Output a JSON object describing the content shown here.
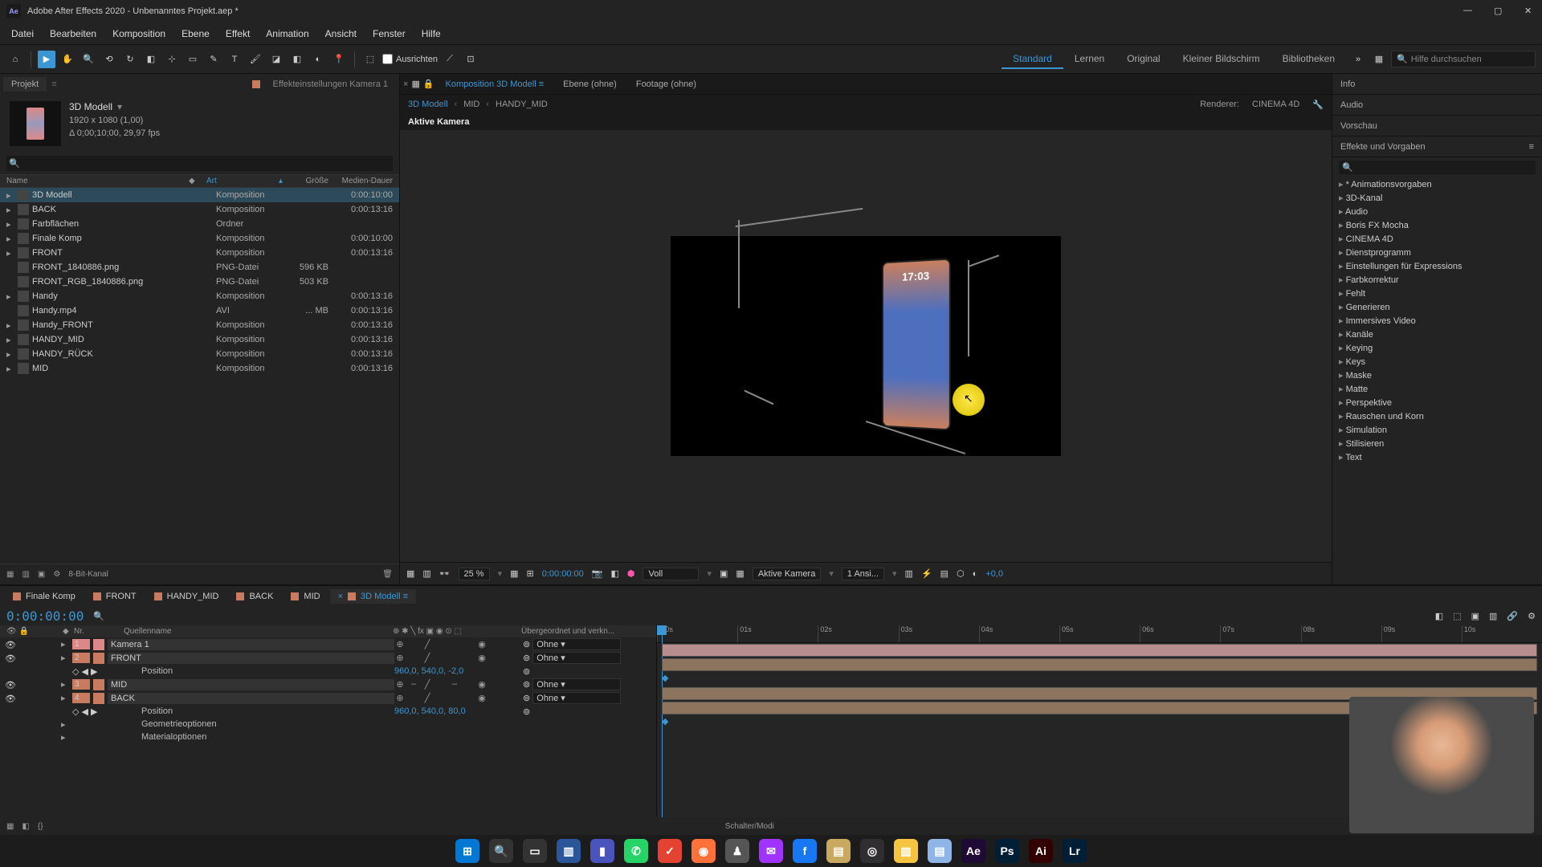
{
  "titlebar": {
    "title": "Adobe After Effects 2020 - Unbenanntes Projekt.aep *"
  },
  "menubar": [
    "Datei",
    "Bearbeiten",
    "Komposition",
    "Ebene",
    "Effekt",
    "Animation",
    "Ansicht",
    "Fenster",
    "Hilfe"
  ],
  "toolbar": {
    "snap_label": "Ausrichten",
    "workspaces": [
      "Standard",
      "Lernen",
      "Original",
      "Kleiner Bildschirm",
      "Bibliotheken"
    ],
    "active_workspace": "Standard",
    "search_placeholder": "Hilfe durchsuchen"
  },
  "project_panel": {
    "tab_project": "Projekt",
    "tab_effect_controls": "Effekteinstellungen Kamera 1",
    "selected_name": "3D Modell",
    "selected_dims": "1920 x 1080 (1,00)",
    "selected_dur": "Δ 0;00;10;00, 29,97 fps",
    "headers": {
      "name": "Name",
      "art": "Art",
      "size": "Größe",
      "dur": "Medien-Dauer"
    },
    "items": [
      {
        "name": "3D Modell",
        "type": "Komposition",
        "size": "",
        "dur": "0:00:10:00",
        "tag": "#b97b56",
        "sel": true,
        "exp": "▸"
      },
      {
        "name": "BACK",
        "type": "Komposition",
        "size": "",
        "dur": "0:00:13:16",
        "tag": "#b97b56",
        "exp": "▸"
      },
      {
        "name": "Farbflächen",
        "type": "Ordner",
        "size": "",
        "dur": "",
        "tag": "#b9b156",
        "exp": "▸"
      },
      {
        "name": "Finale Komp",
        "type": "Komposition",
        "size": "",
        "dur": "0:00:10:00",
        "tag": "#b97b56",
        "exp": "▸"
      },
      {
        "name": "FRONT",
        "type": "Komposition",
        "size": "",
        "dur": "0:00:13:16",
        "tag": "#b97b56",
        "exp": "▸"
      },
      {
        "name": "FRONT_1840886.png",
        "type": "PNG-Datei",
        "size": "596 KB",
        "dur": "",
        "tag": "#6b9b56"
      },
      {
        "name": "FRONT_RGB_1840886.png",
        "type": "PNG-Datei",
        "size": "503 KB",
        "dur": "",
        "tag": "#6b9b56"
      },
      {
        "name": "Handy",
        "type": "Komposition",
        "size": "",
        "dur": "0:00:13:16",
        "tag": "#b97b56",
        "exp": "▸"
      },
      {
        "name": "Handy.mp4",
        "type": "AVI",
        "size": "... MB",
        "dur": "0:00:13:16",
        "tag": "#d67b3e"
      },
      {
        "name": "Handy_FRONT",
        "type": "Komposition",
        "size": "",
        "dur": "0:00:13:16",
        "tag": "#b97b56",
        "exp": "▸"
      },
      {
        "name": "HANDY_MID",
        "type": "Komposition",
        "size": "",
        "dur": "0:00:13:16",
        "tag": "#b97b56",
        "exp": "▸"
      },
      {
        "name": "HANDY_RÜCK",
        "type": "Komposition",
        "size": "",
        "dur": "0:00:13:16",
        "tag": "#b97b56",
        "exp": "▸"
      },
      {
        "name": "MID",
        "type": "Komposition",
        "size": "",
        "dur": "0:00:13:16",
        "tag": "#b97b56",
        "exp": "▸"
      }
    ],
    "footer_bit": "8-Bit-Kanal"
  },
  "comp_panel": {
    "tab_comp_prefix": "Komposition",
    "tab_comp_name": "3D Modell",
    "tab_layer": "Ebene (ohne)",
    "tab_footage": "Footage (ohne)",
    "breadcrumb": [
      "3D Modell",
      "MID",
      "HANDY_MID"
    ],
    "renderer_label": "Renderer:",
    "renderer_value": "CINEMA 4D",
    "viewer_label": "Aktive Kamera",
    "phone_time": "17:03",
    "footer": {
      "zoom": "25 %",
      "time": "0:00:00:00",
      "res": "Voll",
      "camera": "Aktive Kamera",
      "views": "1 Ansi...",
      "exposure": "+0,0"
    }
  },
  "right_panel": {
    "info": "Info",
    "audio": "Audio",
    "preview": "Vorschau",
    "effects_title": "Effekte und Vorgaben",
    "effects": [
      "* Animationsvorgaben",
      "3D-Kanal",
      "Audio",
      "Boris FX Mocha",
      "CINEMA 4D",
      "Dienstprogramm",
      "Einstellungen für Expressions",
      "Farbkorrektur",
      "Fehlt",
      "Generieren",
      "Immersives Video",
      "Kanäle",
      "Keying",
      "Keys",
      "Maske",
      "Matte",
      "Perspektive",
      "Rauschen und Korn",
      "Simulation",
      "Stilisieren",
      "Text"
    ]
  },
  "timeline": {
    "tabs": [
      {
        "label": "Finale Komp",
        "color": "#c97b5f"
      },
      {
        "label": "FRONT",
        "color": "#c97b5f"
      },
      {
        "label": "HANDY_MID",
        "color": "#c97b5f"
      },
      {
        "label": "BACK",
        "color": "#c97b5f"
      },
      {
        "label": "MID",
        "color": "#c97b5f"
      },
      {
        "label": "3D Modell",
        "color": "#c97b5f",
        "active": true
      }
    ],
    "timecode": "0:00:00:00",
    "header": {
      "nr": "Nr.",
      "source": "Quellenname",
      "parent": "Übergeordnet und verkn..."
    },
    "ruler": [
      ":00s",
      "01s",
      "02s",
      "03s",
      "04s",
      "05s",
      "06s",
      "07s",
      "08s",
      "09s",
      "10s"
    ],
    "layers": [
      {
        "num": "1",
        "name": "Kamera 1",
        "tag": "#d88",
        "parent": "Ohne",
        "bar": "#b98d8d"
      },
      {
        "num": "2",
        "name": "FRONT",
        "tag": "#c97b5f",
        "parent": "Ohne",
        "bar": "#8c745f",
        "prop": {
          "label": "Position",
          "value": "960,0, 540,0, -2,0"
        }
      },
      {
        "num": "3",
        "name": "MID",
        "tag": "#c97b5f",
        "parent": "Ohne",
        "bar": "#8c745f",
        "dash": true
      },
      {
        "num": "4",
        "name": "BACK",
        "tag": "#c97b5f",
        "parent": "Ohne",
        "bar": "#8c745f",
        "prop": {
          "label": "Position",
          "value": "960,0, 540,0, 80,0"
        },
        "extra": [
          "Geometrieoptionen",
          "Materialoptionen"
        ]
      }
    ],
    "footer_toggle": "Schalter/Modi"
  },
  "taskbar": {
    "icons": [
      {
        "name": "windows-start",
        "bg": "#0078d4",
        "txt": "⊞"
      },
      {
        "name": "search",
        "bg": "#333",
        "txt": "🔍"
      },
      {
        "name": "task-view",
        "bg": "#333",
        "txt": "▭"
      },
      {
        "name": "explorer",
        "bg": "#2b579a",
        "txt": "▥"
      },
      {
        "name": "teams",
        "bg": "#4b53bc",
        "txt": "▮"
      },
      {
        "name": "whatsapp",
        "bg": "#25d366",
        "txt": "✆"
      },
      {
        "name": "todoist",
        "bg": "#e44332",
        "txt": "✓"
      },
      {
        "name": "firefox",
        "bg": "#ff7139",
        "txt": "◉"
      },
      {
        "name": "app1",
        "bg": "#555",
        "txt": "♟"
      },
      {
        "name": "messenger",
        "bg": "#a033ff",
        "txt": "✉"
      },
      {
        "name": "facebook",
        "bg": "#1877f2",
        "txt": "f"
      },
      {
        "name": "notes",
        "bg": "#c9a85f",
        "txt": "▤"
      },
      {
        "name": "obs",
        "bg": "#302e31",
        "txt": "◎"
      },
      {
        "name": "files",
        "bg": "#f5c542",
        "txt": "▥"
      },
      {
        "name": "editor",
        "bg": "#8fb5e6",
        "txt": "▤"
      },
      {
        "name": "after-effects",
        "bg": "#1f0a36",
        "txt": "Ae"
      },
      {
        "name": "photoshop",
        "bg": "#001e36",
        "txt": "Ps"
      },
      {
        "name": "illustrator",
        "bg": "#330000",
        "txt": "Ai"
      },
      {
        "name": "lightroom",
        "bg": "#001e36",
        "txt": "Lr"
      }
    ]
  }
}
